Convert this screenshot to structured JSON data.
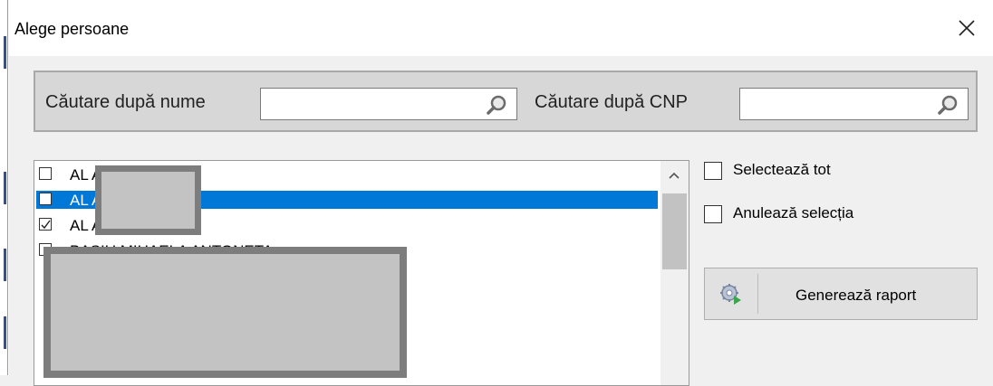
{
  "window": {
    "title": "Alege persoane",
    "close_icon": "close-icon"
  },
  "search": {
    "name_label": "Căutare după nume",
    "name_value": "",
    "cnp_label": "Căutare după CNP",
    "cnp_value": "",
    "icon": "magnifier-icon"
  },
  "list": {
    "rows": [
      {
        "text": "AL              A",
        "checked": false,
        "selected": false
      },
      {
        "text": "AL              A",
        "checked": false,
        "selected": true
      },
      {
        "text": "AL              A",
        "checked": true,
        "selected": false
      },
      {
        "text": "BASIU MIHAELA ANTONETA",
        "checked": false,
        "selected": false
      }
    ],
    "selected_color": "#0078d7"
  },
  "options": {
    "select_all": "Selectează tot",
    "clear_selection": "Anulează selecția"
  },
  "actions": {
    "generate_label": "Generează raport",
    "generate_icon": "gear-play-icon"
  }
}
